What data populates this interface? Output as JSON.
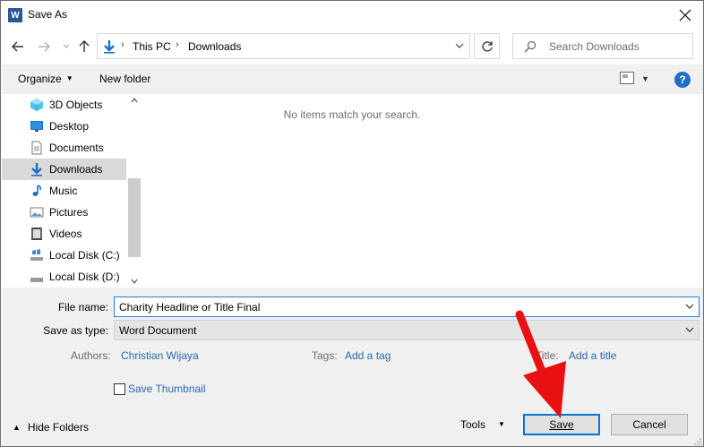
{
  "window": {
    "title": "Save As",
    "app_icon_letter": "W"
  },
  "address": {
    "crumbs": [
      "This PC",
      "Downloads"
    ],
    "search_placeholder": "Search Downloads"
  },
  "toolbar": {
    "organize_label": "Organize",
    "new_folder_label": "New folder",
    "help_label": "?"
  },
  "navpane": {
    "items": [
      {
        "label": "3D Objects",
        "icon": "3d-objects-icon"
      },
      {
        "label": "Desktop",
        "icon": "desktop-icon"
      },
      {
        "label": "Documents",
        "icon": "documents-icon"
      },
      {
        "label": "Downloads",
        "icon": "downloads-icon",
        "selected": true
      },
      {
        "label": "Music",
        "icon": "music-icon"
      },
      {
        "label": "Pictures",
        "icon": "pictures-icon"
      },
      {
        "label": "Videos",
        "icon": "videos-icon"
      },
      {
        "label": "Local Disk (C:)",
        "icon": "drive-icon"
      },
      {
        "label": "Local Disk (D:)",
        "icon": "drive-icon"
      }
    ]
  },
  "files": {
    "empty_message": "No items match your search."
  },
  "form": {
    "file_name_label": "File name:",
    "file_name_value": "Charity Headline or Title Final",
    "save_type_label": "Save as type:",
    "save_type_value": "Word Document",
    "authors_label": "Authors:",
    "authors_value": "Christian Wijaya",
    "tags_label": "Tags:",
    "tags_value": "Add a tag",
    "title_label": "Title:",
    "title_value": "Add a title",
    "thumbnail_label": "Save Thumbnail",
    "thumbnail_checked": false
  },
  "footer": {
    "hide_folders_label": "Hide Folders",
    "tools_label": "Tools",
    "save_label": "Save",
    "cancel_label": "Cancel"
  },
  "colors": {
    "accent": "#0078d7",
    "link": "#2a69b1",
    "annotation_arrow": "#e81010"
  }
}
